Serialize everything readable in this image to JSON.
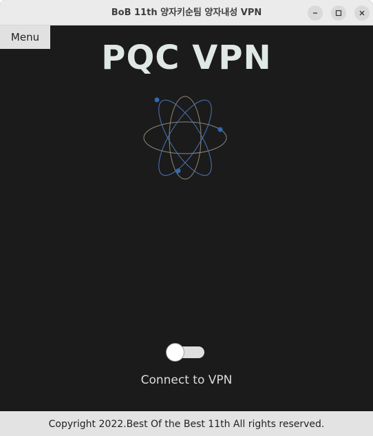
{
  "window": {
    "title": "BoB 11th 양자키순팀 양자내성 VPN",
    "controls": [
      "minimize-icon",
      "maximize-icon",
      "close-icon"
    ]
  },
  "menu": {
    "label": "Menu"
  },
  "main": {
    "app_title": "PQC VPN",
    "logo_icon": "atom-icon",
    "toggle": {
      "state": "off"
    },
    "connect_label": "Connect to VPN"
  },
  "footer": {
    "copyright": "Copyright 2022.Best Of the Best 11th All rights reserved."
  },
  "colors": {
    "background": "#1c1b1b",
    "title_text": "#dfe8e4",
    "atom_orbit_blue": "#4a78b8",
    "atom_electron": "#2f6bb3",
    "atom_orbit_gray": "#8a8a7a"
  }
}
